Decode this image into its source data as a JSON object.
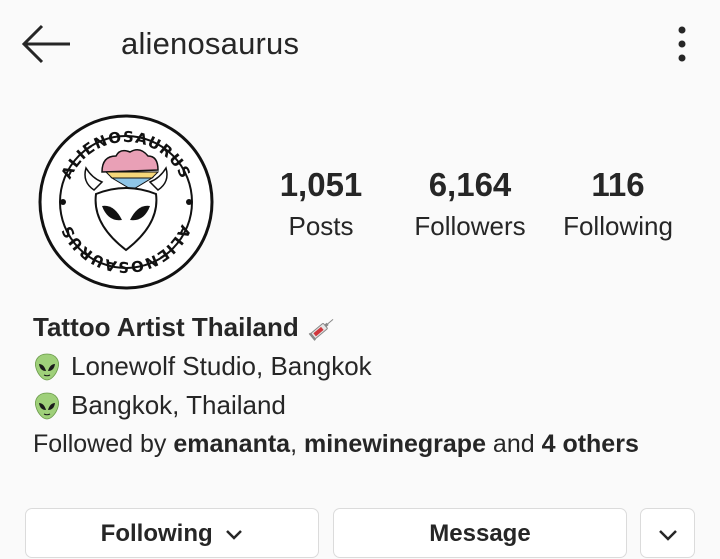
{
  "header": {
    "username": "alienosaurus",
    "back_icon": "arrow-left-icon",
    "more_icon": "vertical-dots-icon"
  },
  "profile": {
    "avatar_ring_text": "ALIENOSAURUS",
    "stats": {
      "posts": {
        "value": "1,051",
        "label": "Posts"
      },
      "followers": {
        "value": "6,164",
        "label": "Followers"
      },
      "following": {
        "value": "116",
        "label": "Following"
      }
    },
    "bio": {
      "name": "Tattoo Artist Thailand",
      "name_emoji": "syringe-icon",
      "line1": "Lonewolf Studio, Bangkok",
      "line2": "Bangkok, Thailand",
      "line_emoji": "alien-icon"
    },
    "followed_by": {
      "prefix": "Followed by ",
      "user1": "emananta",
      "sep": ", ",
      "user2": "minewinegrape",
      "and": " and ",
      "others": "4 others"
    }
  },
  "actions": {
    "following_label": "Following",
    "message_label": "Message"
  },
  "colors": {
    "background": "#fafafa",
    "text": "#262626",
    "border": "#dbdbdb"
  }
}
